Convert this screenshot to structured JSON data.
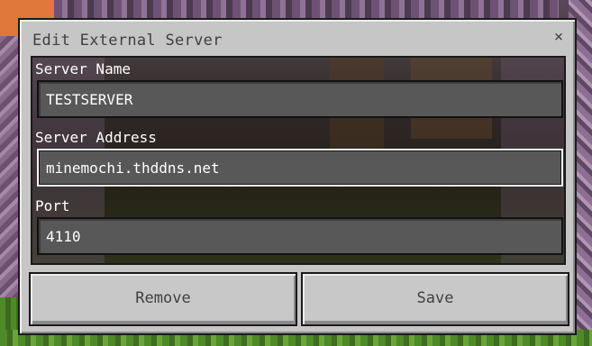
{
  "dialog": {
    "title": "Edit External Server",
    "close_symbol": "×"
  },
  "fields": {
    "server_name": {
      "label": "Server Name",
      "value": "TESTSERVER"
    },
    "server_address": {
      "label": "Server Address",
      "value": "minemochi.thddns.net"
    },
    "port": {
      "label": "Port",
      "value": "4110"
    }
  },
  "buttons": {
    "remove_label": "Remove",
    "save_label": "Save"
  },
  "icons": {
    "close": "close-icon"
  },
  "colors": {
    "dialog_bg": "#c6c6c6",
    "field_bg": "#585858",
    "field_text": "#ffffff",
    "button_bg": "#c8c8c8",
    "title_text": "#3f3f3f"
  }
}
